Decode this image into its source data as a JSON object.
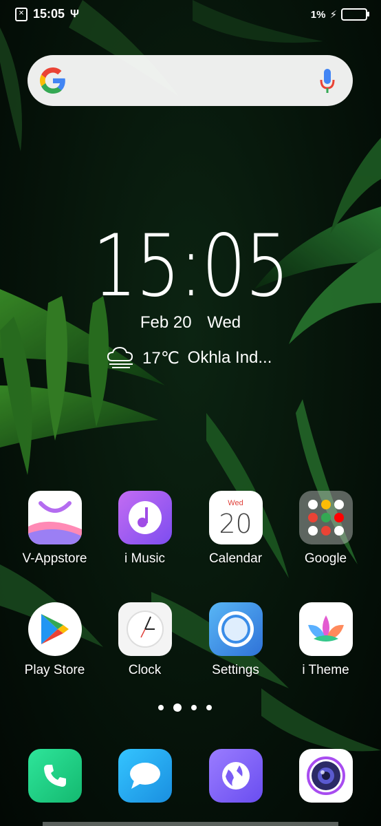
{
  "status_bar": {
    "time": "15:05",
    "battery": "1%"
  },
  "clock_widget": {
    "time": "15:05",
    "date": "Feb 20",
    "day": "Wed",
    "temperature": "17℃",
    "location": "Okhla Ind..."
  },
  "apps_row1": [
    {
      "label": "V-Appstore",
      "icon": "appstore-icon"
    },
    {
      "label": "i Music",
      "icon": "music-icon"
    },
    {
      "label": "Calendar",
      "icon": "calendar-icon",
      "day_label": "Wed",
      "day_number": "20"
    },
    {
      "label": "Google",
      "icon": "google-folder-icon"
    }
  ],
  "apps_row2": [
    {
      "label": "Play Store",
      "icon": "play-store-icon"
    },
    {
      "label": "Clock",
      "icon": "clock-icon"
    },
    {
      "label": "Settings",
      "icon": "settings-icon"
    },
    {
      "label": "i Theme",
      "icon": "theme-icon"
    }
  ],
  "dock": [
    {
      "icon": "phone-icon"
    },
    {
      "icon": "messages-icon"
    },
    {
      "icon": "browser-icon"
    },
    {
      "icon": "camera-icon"
    }
  ],
  "page_indicator": {
    "pages": 4,
    "current": 2
  },
  "colors": {
    "wallpaper": "#06140a",
    "phone": "#1fcf86",
    "messages": "#1ea7f0",
    "music": "#a04ce6",
    "settings": "#3a8de8"
  }
}
